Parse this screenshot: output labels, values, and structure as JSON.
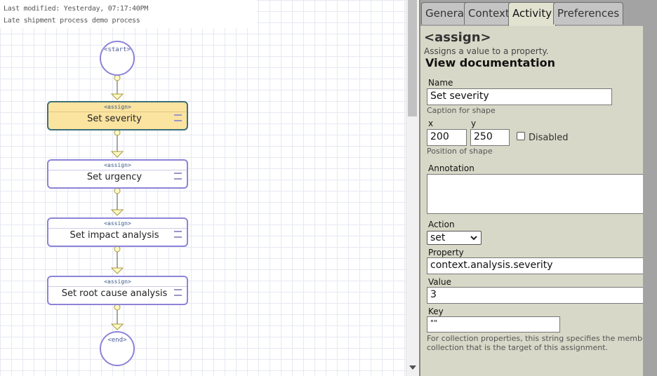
{
  "info": {
    "last_modified": "Last modified: Yesterday, 07:17:40PM",
    "description": "Late shipment process demo process"
  },
  "diagram": {
    "start_label": "<start>",
    "end_label": "<end>",
    "shapes": [
      {
        "tag": "<assign>",
        "caption": "Set severity",
        "selected": true
      },
      {
        "tag": "<assign>",
        "caption": "Set urgency",
        "selected": false
      },
      {
        "tag": "<assign>",
        "caption": "Set impact analysis",
        "selected": false
      },
      {
        "tag": "<assign>",
        "caption": "Set root cause analysis",
        "selected": false
      }
    ]
  },
  "tabs": [
    {
      "label": "General",
      "active": false
    },
    {
      "label": "Context",
      "active": false
    },
    {
      "label": "Activity",
      "active": true
    },
    {
      "label": "Preferences",
      "active": false
    }
  ],
  "panel": {
    "heading": "<assign>",
    "description": "Assigns a value to a property.",
    "doc_link": "View documentation",
    "name_label": "Name",
    "name_value": "Set severity",
    "name_hint": "Caption for shape",
    "x_label": "x",
    "y_label": "y",
    "x_value": "200",
    "y_value": "250",
    "disabled_label": "Disabled",
    "position_hint": "Position of shape",
    "annotation_label": "Annotation",
    "annotation_value": "",
    "action_label": "Action",
    "action_value": "set",
    "property_label": "Property",
    "property_value": "context.analysis.severity",
    "value_label": "Value",
    "value_value": "3",
    "key_label": "Key",
    "key_value": "\"\"",
    "key_hint_1": "For collection properties, this string specifies the member",
    "key_hint_2": "collection that is the target of this assignment."
  },
  "colors": {
    "node_border": "#8d84d8",
    "selected_fill": "#fbe3a0",
    "selected_border": "#3e6f78",
    "connector": "#8a8a8a",
    "port_fill": "#fff9c4",
    "panel_bg": "#d8d8c8"
  }
}
